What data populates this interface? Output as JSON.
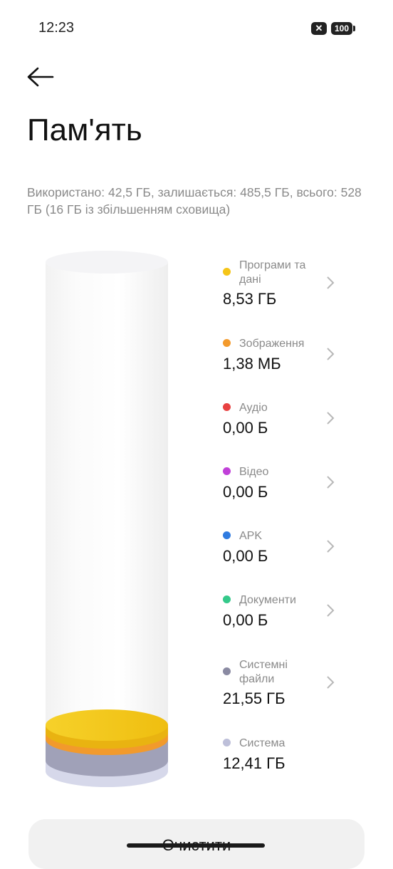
{
  "status_bar": {
    "time": "12:23",
    "close_badge": "✕",
    "battery": "100"
  },
  "page": {
    "title": "Пам'ять",
    "summary": "Використано: 42,5 ГБ, залишається: 485,5 ГБ, всього: 528 ГБ (16 ГБ із збільшенням сховища)"
  },
  "legend": [
    {
      "name": "Програми та дані",
      "value": "8,53 ГБ",
      "color": "#f5c518"
    },
    {
      "name": "Зображення",
      "value": "1,38 МБ",
      "color": "#f39a2c"
    },
    {
      "name": "Аудіо",
      "value": "0,00 Б",
      "color": "#e84141"
    },
    {
      "name": "Відео",
      "value": "0,00 Б",
      "color": "#c040d8"
    },
    {
      "name": "APK",
      "value": "0,00 Б",
      "color": "#2f7be0"
    },
    {
      "name": "Документи",
      "value": "0,00 Б",
      "color": "#34c98a"
    },
    {
      "name": "Системні файли",
      "value": "21,55 ГБ",
      "color": "#8a8aa2"
    },
    {
      "name": "Система",
      "value": "12,41 ГБ",
      "color": "#bdbfd9"
    }
  ],
  "actions": {
    "clean_label": "Очистити"
  }
}
